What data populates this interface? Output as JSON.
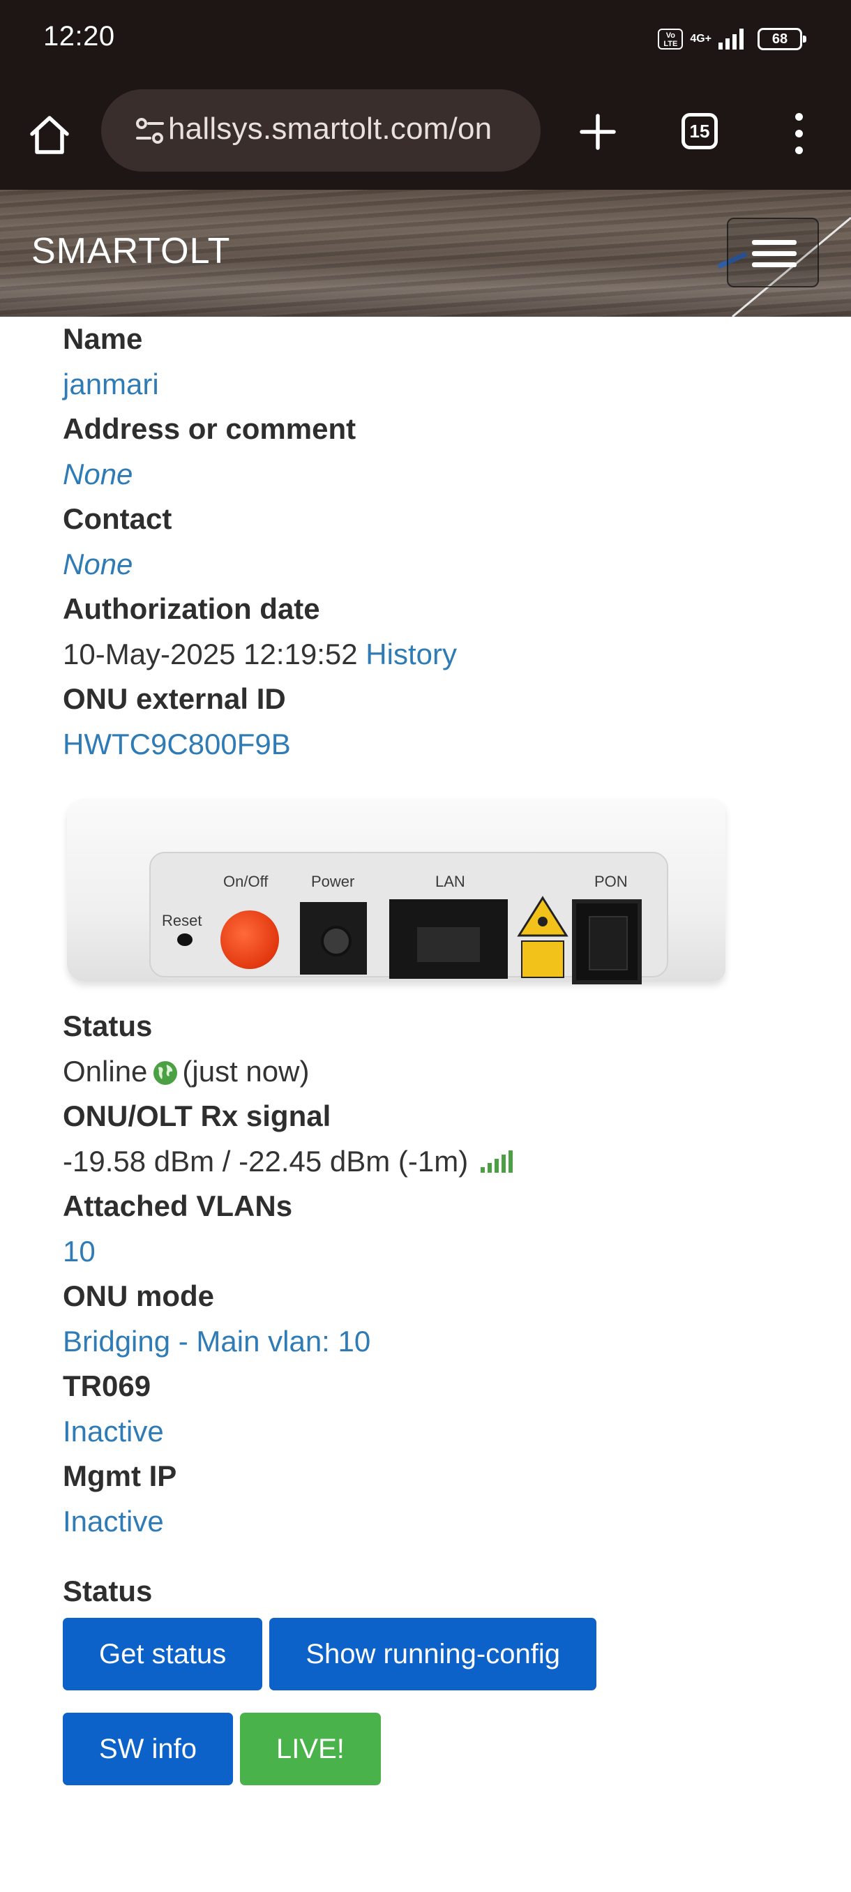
{
  "status_bar": {
    "time": "12:20",
    "volte": "Vo LTE",
    "network": "4G+",
    "battery": "68"
  },
  "browser": {
    "url": "hallsys.smartolt.com/on",
    "tab_count": "15",
    "icons": [
      "home-icon",
      "site-settings-icon",
      "new-tab-icon",
      "tab-switcher-icon",
      "more-menu-icon"
    ]
  },
  "site": {
    "brand": "SMARTOLT",
    "header_color": "#5f534a"
  },
  "details": {
    "name_label": "Name",
    "name": "janmari",
    "address_label": "Address or comment",
    "address": "None",
    "contact_label": "Contact",
    "contact": "None",
    "auth_date_label": "Authorization date",
    "auth_date": "10-May-2025 12:19:52",
    "history_link": "History",
    "external_id_label": "ONU external ID",
    "external_id": "HWTC9C800F9B"
  },
  "device_image": {
    "labels": {
      "reset": "Reset",
      "onoff": "On/Off",
      "power": "Power",
      "lan": "LAN",
      "pon": "PON",
      "laser": "CLASS 1 LASER PRODUCT"
    }
  },
  "status": {
    "status_label": "Status",
    "status_value": "Online",
    "status_time": "(just now)",
    "rx_label": "ONU/OLT Rx signal",
    "rx_value": "-19.58 dBm / -22.45 dBm (-1m)",
    "vlans_label": "Attached VLANs",
    "vlans": "10",
    "mode_label": "ONU mode",
    "mode": "Bridging - Main vlan: 10",
    "tr069_label": "TR069",
    "tr069": "Inactive",
    "mgmt_label": "Mgmt IP",
    "mgmt": "Inactive"
  },
  "actions": {
    "section_label": "Status",
    "get_status": "Get status",
    "show_running_config": "Show running-config",
    "sw_info": "SW info",
    "live": "LIVE!"
  },
  "colors": {
    "link": "#2e7bb6",
    "button_primary": "#0c62c9",
    "button_success": "#4ab24a",
    "online_globe": "#4aa043"
  }
}
